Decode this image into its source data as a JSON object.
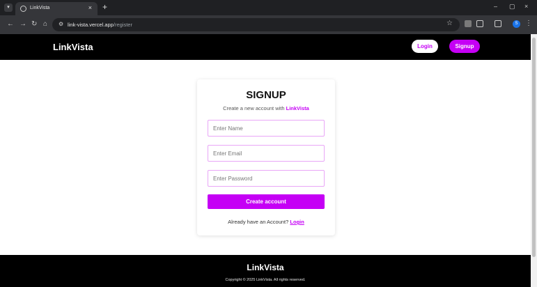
{
  "browser": {
    "tab_title": "LinkVista",
    "tab_close": "×",
    "new_tab": "+",
    "url_host": "link-vista.vercel.app",
    "url_path": "/register",
    "nav": {
      "back": "←",
      "forward": "→",
      "reload": "↻",
      "home": "⌂"
    },
    "window": {
      "minimize": "–",
      "maximize": "▢",
      "close": "×"
    },
    "profile_initial": "S"
  },
  "navbar": {
    "brand": "LinkVista",
    "login_label": "Login",
    "signup_label": "Signup"
  },
  "signup_card": {
    "title": "SIGNUP",
    "subtitle_prefix": "Create a new account with ",
    "subtitle_brand": "LinkVista",
    "name_placeholder": "Enter Name",
    "email_placeholder": "Enter Email",
    "password_placeholder": "Enter Password",
    "submit_label": "Create account",
    "already_text": "Already have an Account? ",
    "login_link": "Login"
  },
  "footer": {
    "brand": "LinkVista",
    "copyright": "Copyright © 2025 LinkVista. All rights reserved."
  },
  "colors": {
    "accent": "#c500f5",
    "navbar_bg": "#000000",
    "field_border": "#e9a6f7"
  }
}
